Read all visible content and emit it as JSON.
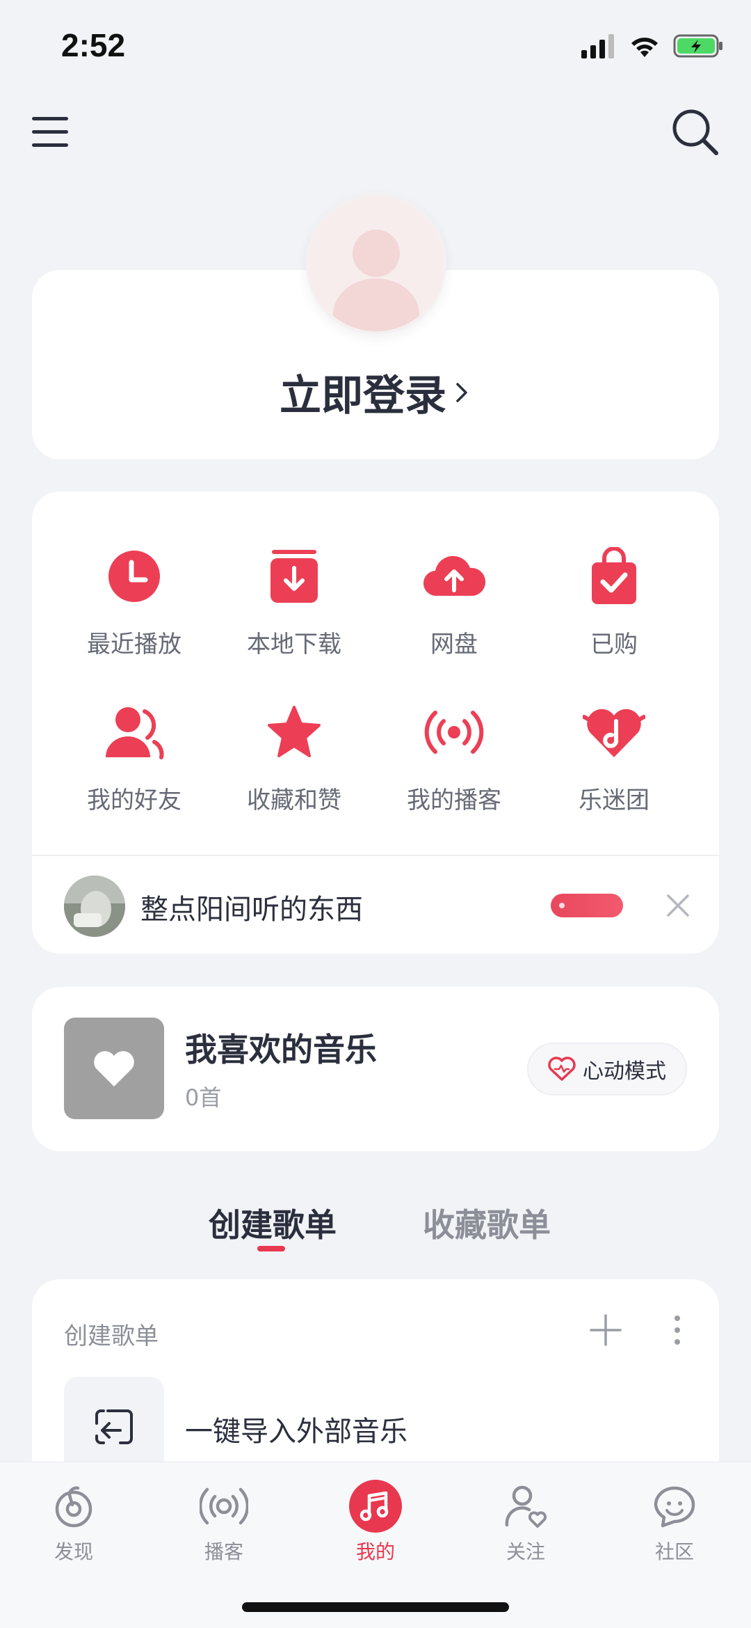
{
  "status": {
    "time": "2:52"
  },
  "login": {
    "label": "立即登录"
  },
  "grid": [
    {
      "label": "最近播放",
      "icon": "clock-icon"
    },
    {
      "label": "本地下载",
      "icon": "download-icon"
    },
    {
      "label": "网盘",
      "icon": "cloud-upload-icon"
    },
    {
      "label": "已购",
      "icon": "shopping-bag-icon"
    },
    {
      "label": "我的好友",
      "icon": "friends-icon"
    },
    {
      "label": "收藏和赞",
      "icon": "star-icon"
    },
    {
      "label": "我的播客",
      "icon": "podcast-icon"
    },
    {
      "label": "乐迷团",
      "icon": "fan-club-icon"
    }
  ],
  "recommendation": {
    "text": "整点阳间听的东西"
  },
  "favorites": {
    "title": "我喜欢的音乐",
    "count": "0首",
    "mode_button": "心动模式"
  },
  "tabs": [
    {
      "label": "创建歌单",
      "active": true
    },
    {
      "label": "收藏歌单",
      "active": false
    }
  ],
  "playlist_section": {
    "header": "创建歌单",
    "import_label": "一键导入外部音乐"
  },
  "bottom_nav": [
    {
      "label": "发现",
      "icon": "discover-icon",
      "active": false
    },
    {
      "label": "播客",
      "icon": "podcast-icon",
      "active": false
    },
    {
      "label": "我的",
      "icon": "music-note-icon",
      "active": true
    },
    {
      "label": "关注",
      "icon": "follow-icon",
      "active": false
    },
    {
      "label": "社区",
      "icon": "community-icon",
      "active": false
    }
  ],
  "colors": {
    "accent": "#e8384f",
    "background": "#f2f3f6"
  }
}
